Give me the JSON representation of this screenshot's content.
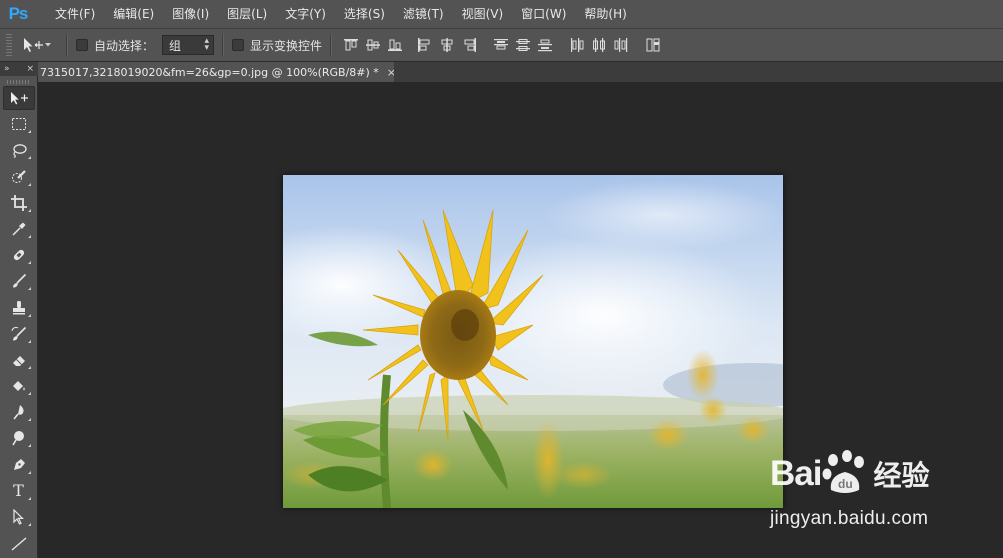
{
  "app": {
    "logo": "Ps"
  },
  "menu": [
    {
      "label": "文件(F)"
    },
    {
      "label": "编辑(E)"
    },
    {
      "label": "图像(I)"
    },
    {
      "label": "图层(L)"
    },
    {
      "label": "文字(Y)"
    },
    {
      "label": "选择(S)"
    },
    {
      "label": "滤镜(T)"
    },
    {
      "label": "视图(V)"
    },
    {
      "label": "窗口(W)"
    },
    {
      "label": "帮助(H)"
    }
  ],
  "options": {
    "tool_icon": "move-tool-icon",
    "auto_select_label": "自动选择：",
    "auto_select_checked": false,
    "auto_select_value": "组",
    "show_transform_label": "显示变换控件",
    "show_transform_checked": false
  },
  "tools_panel": {
    "expand_icon": "»",
    "close_icon": "×"
  },
  "tools": [
    {
      "icon": "move-tool-icon",
      "active": true
    },
    {
      "icon": "marquee-tool-icon"
    },
    {
      "icon": "lasso-tool-icon"
    },
    {
      "icon": "quick-selection-tool-icon"
    },
    {
      "icon": "crop-tool-icon"
    },
    {
      "icon": "eyedropper-tool-icon"
    },
    {
      "icon": "healing-brush-tool-icon"
    },
    {
      "icon": "brush-tool-icon"
    },
    {
      "icon": "clone-stamp-tool-icon"
    },
    {
      "icon": "history-brush-tool-icon"
    },
    {
      "icon": "eraser-tool-icon"
    },
    {
      "icon": "paint-bucket-tool-icon"
    },
    {
      "icon": "blur-tool-icon"
    },
    {
      "icon": "dodge-tool-icon"
    },
    {
      "icon": "pen-tool-icon"
    },
    {
      "icon": "type-tool-icon",
      "text": "T"
    },
    {
      "icon": "path-selection-tool-icon"
    },
    {
      "icon": "line-tool-icon"
    }
  ],
  "document": {
    "tab_title": "7315017,3218019020&fm=26&gp=0.jpg @ 100%(RGB/8#) *",
    "close_label": "×"
  },
  "watermark": {
    "brand": "Bai",
    "brand_suffix": "经验",
    "url": "jingyan.baidu.com"
  }
}
